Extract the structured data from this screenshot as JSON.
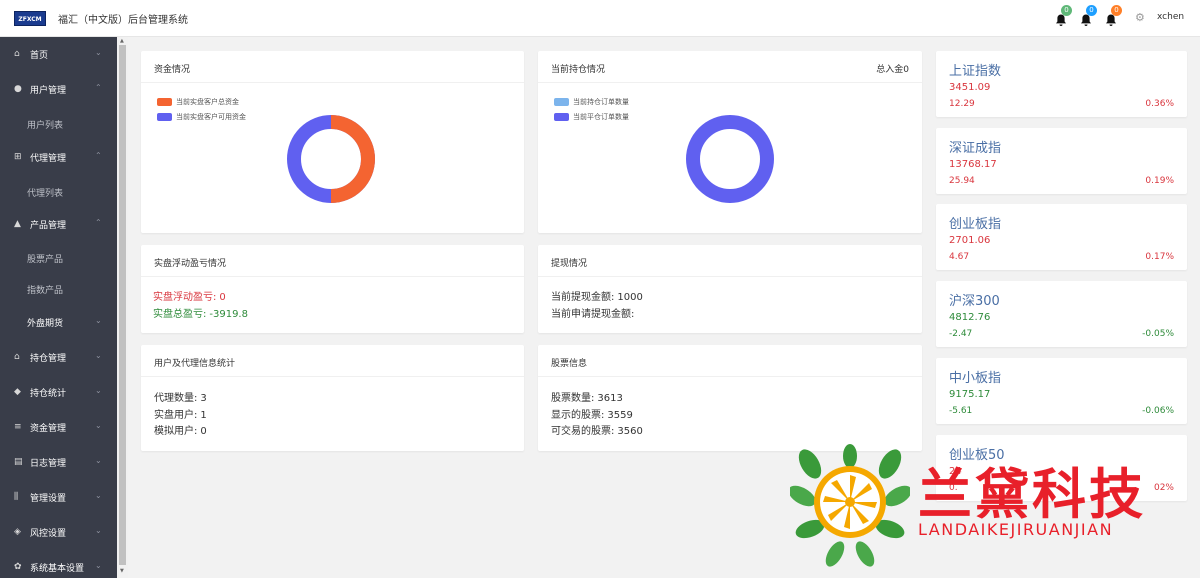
{
  "header": {
    "logo_text": "ZFXCM",
    "title": "福汇（中文版）后台管理系统",
    "notifications": [
      {
        "icon": "bell-icon",
        "count": "0",
        "color": "#5fb878"
      },
      {
        "icon": "bell-icon",
        "count": "0",
        "color": "#1e9fff"
      },
      {
        "icon": "bell-icon",
        "count": "0",
        "color": "#ff7f27"
      }
    ],
    "settings_icon": "gear-icon",
    "username": "xchen"
  },
  "sidebar": {
    "items": [
      {
        "label": "首页",
        "icon": "home-icon",
        "chevron": "⌄"
      },
      {
        "label": "用户管理",
        "icon": "user-icon",
        "chevron": "⌃"
      },
      {
        "label": "用户列表",
        "sub": true
      },
      {
        "label": "代理管理",
        "icon": "org-icon",
        "chevron": "⌃"
      },
      {
        "label": "代理列表",
        "sub": true
      },
      {
        "label": "产品管理",
        "icon": "product-icon",
        "chevron": "⌃"
      },
      {
        "label": "股票产品",
        "sub": true
      },
      {
        "label": "指数产品",
        "sub": true
      },
      {
        "label": "外盘期货",
        "icon": "",
        "chevron": "⌄"
      },
      {
        "label": "持仓管理",
        "icon": "house-icon",
        "chevron": "⌄"
      },
      {
        "label": "持仓统计",
        "icon": "cube-icon",
        "chevron": "⌄"
      },
      {
        "label": "资金管理",
        "icon": "coins-icon",
        "chevron": "⌄"
      },
      {
        "label": "日志管理",
        "icon": "log-icon",
        "chevron": "⌄"
      },
      {
        "label": "管理设置",
        "icon": "sliders-icon",
        "chevron": "⌄"
      },
      {
        "label": "风控设置",
        "icon": "shield-icon",
        "chevron": "⌄"
      },
      {
        "label": "系统基本设置",
        "icon": "cog-icon",
        "chevron": "⌄"
      }
    ]
  },
  "funds": {
    "title": "资金情况",
    "legend": [
      {
        "label": "当前实盘客户总资金",
        "color": "#f46431"
      },
      {
        "label": "当前实盘客户可用资金",
        "color": "#6060f0"
      }
    ],
    "share_total": 0.5,
    "share_available": 0.5
  },
  "positions": {
    "title": "当前持仓情况",
    "extra": "总入金0",
    "legend": [
      {
        "label": "当前持仓订单数量",
        "color": "#7cb4ec"
      },
      {
        "label": "当前平仓订单数量",
        "color": "#6060f0"
      }
    ],
    "share_open": 0,
    "share_closed": 1
  },
  "floating": {
    "title": "实盘浮动盈亏情况",
    "pnl_label": "实盘浮动盈亏:",
    "pnl_value": "0",
    "total_label": "实盘总盈亏:",
    "total_value": "-3919.8"
  },
  "withdraw": {
    "title": "提现情况",
    "amount_label": "当前提现金额:",
    "amount_value": "1000",
    "pending_label": "当前申请提现金额:",
    "pending_value": ""
  },
  "users": {
    "title": "用户及代理信息统计",
    "agents_label": "代理数量:",
    "agents_value": "3",
    "real_label": "实盘用户:",
    "real_value": "1",
    "sim_label": "模拟用户:",
    "sim_value": "0"
  },
  "stocks": {
    "title": "股票信息",
    "count_label": "股票数量:",
    "count_value": "3613",
    "shown_label": "显示的股票:",
    "shown_value": "3559",
    "tradable_label": "可交易的股票:",
    "tradable_value": "3560"
  },
  "indices": [
    {
      "name": "上证指数",
      "price": "3451.09",
      "change": "12.29",
      "pct": "0.36%",
      "trend": "up"
    },
    {
      "name": "深证成指",
      "price": "13768.17",
      "change": "25.94",
      "pct": "0.19%",
      "trend": "up"
    },
    {
      "name": "创业板指",
      "price": "2701.06",
      "change": "4.67",
      "pct": "0.17%",
      "trend": "up"
    },
    {
      "name": "沪深300",
      "price": "4812.76",
      "change": "-2.47",
      "pct": "-0.05%",
      "trend": "down"
    },
    {
      "name": "中小板指",
      "price": "9175.17",
      "change": "-5.61",
      "pct": "-0.06%",
      "trend": "down"
    },
    {
      "name": "创业板50",
      "price": "24",
      "change": "0.",
      "pct": "02%",
      "trend": "up"
    }
  ],
  "watermark": {
    "text_cn": "兰黛科技",
    "text_en": "LANDAIKEJIRUANJIAN",
    "color": "#e8202a"
  },
  "colors": {
    "sidebar_bg": "#393d49",
    "up": "#d9363e",
    "down": "#2e8b3a"
  }
}
